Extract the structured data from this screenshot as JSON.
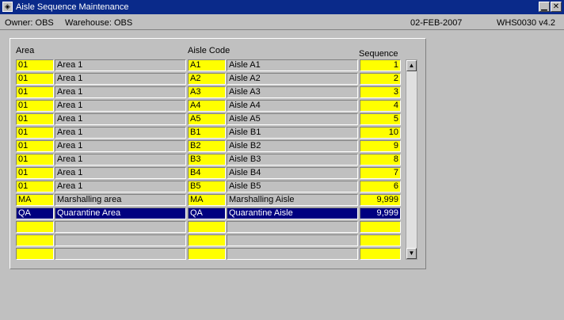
{
  "window": {
    "title": "Aisle Sequence Maintenance",
    "icon": "oracle-forms-icon"
  },
  "status": {
    "owner": "Owner: OBS",
    "warehouse": "Warehouse: OBS",
    "date": "02-FEB-2007",
    "version": "WHS0030 v4.2"
  },
  "columns": {
    "area": "Area",
    "aisle_code": "Aisle Code",
    "sequence": "Sequence"
  },
  "rows": [
    {
      "area": "01",
      "area_desc": "Area 1",
      "aisle": "A1",
      "aisle_name": "Aisle A1",
      "sequence": "1"
    },
    {
      "area": "01",
      "area_desc": "Area 1",
      "aisle": "A2",
      "aisle_name": "Aisle A2",
      "sequence": "2"
    },
    {
      "area": "01",
      "area_desc": "Area 1",
      "aisle": "A3",
      "aisle_name": "Aisle A3",
      "sequence": "3"
    },
    {
      "area": "01",
      "area_desc": "Area 1",
      "aisle": "A4",
      "aisle_name": "Aisle A4",
      "sequence": "4"
    },
    {
      "area": "01",
      "area_desc": "Area 1",
      "aisle": "A5",
      "aisle_name": "Aisle A5",
      "sequence": "5"
    },
    {
      "area": "01",
      "area_desc": "Area 1",
      "aisle": "B1",
      "aisle_name": "Aisle B1",
      "sequence": "10"
    },
    {
      "area": "01",
      "area_desc": "Area 1",
      "aisle": "B2",
      "aisle_name": "Aisle B2",
      "sequence": "9"
    },
    {
      "area": "01",
      "area_desc": "Area 1",
      "aisle": "B3",
      "aisle_name": "Aisle B3",
      "sequence": "8"
    },
    {
      "area": "01",
      "area_desc": "Area 1",
      "aisle": "B4",
      "aisle_name": "Aisle B4",
      "sequence": "7"
    },
    {
      "area": "01",
      "area_desc": "Area 1",
      "aisle": "B5",
      "aisle_name": "Aisle B5",
      "sequence": "6"
    },
    {
      "area": "MA",
      "area_desc": "Marshalling area",
      "aisle": "MA",
      "aisle_name": "Marshalling Aisle",
      "sequence": "9,999"
    },
    {
      "area": "QA",
      "area_desc": "Quarantine Area",
      "aisle": "QA",
      "aisle_name": "Quarantine Aisle",
      "sequence": "9,999",
      "selected": true
    },
    {
      "area": "",
      "area_desc": "",
      "aisle": "",
      "aisle_name": "",
      "sequence": ""
    },
    {
      "area": "",
      "area_desc": "",
      "aisle": "",
      "aisle_name": "",
      "sequence": ""
    },
    {
      "area": "",
      "area_desc": "",
      "aisle": "",
      "aisle_name": "",
      "sequence": ""
    }
  ],
  "colors": {
    "title_bar": "#0a2a8a",
    "field_yellow": "#ffff00",
    "selection": "#000080",
    "background": "#c0c0c0"
  }
}
